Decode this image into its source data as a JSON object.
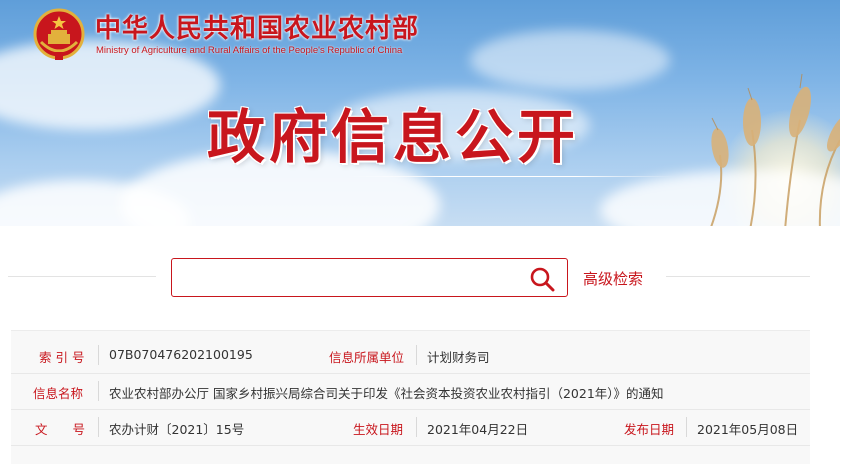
{
  "header": {
    "ministry_cn": "中华人民共和国农业农村部",
    "ministry_en": "Ministry of Agriculture and Rural Affairs of the People's Republic of China",
    "banner_title": "政府信息公开",
    "emblem_icon": "national-emblem-icon"
  },
  "search": {
    "value": "",
    "placeholder": "",
    "icon": "search-icon",
    "advanced_label": "高级检索"
  },
  "info": {
    "index_label": "索 引 号",
    "index_value": "07B070476202100195",
    "unit_label": "信息所属单位",
    "unit_value": "计划财务司",
    "name_label": "信息名称",
    "name_value": "农业农村部办公厅 国家乡村振兴局综合司关于印发《社会资本投资农业农村指引（2021年）》的通知",
    "doc_label": "文　　号",
    "doc_value": "农办计财〔2021〕15号",
    "effective_label": "生效日期",
    "effective_value": "2021年04月22日",
    "publish_label": "发布日期",
    "publish_value": "2021年05月08日"
  },
  "colors": {
    "brand_red": "#c8161d",
    "sky_blue": "#7fb4e6",
    "table_bg": "#f8f8f8"
  }
}
